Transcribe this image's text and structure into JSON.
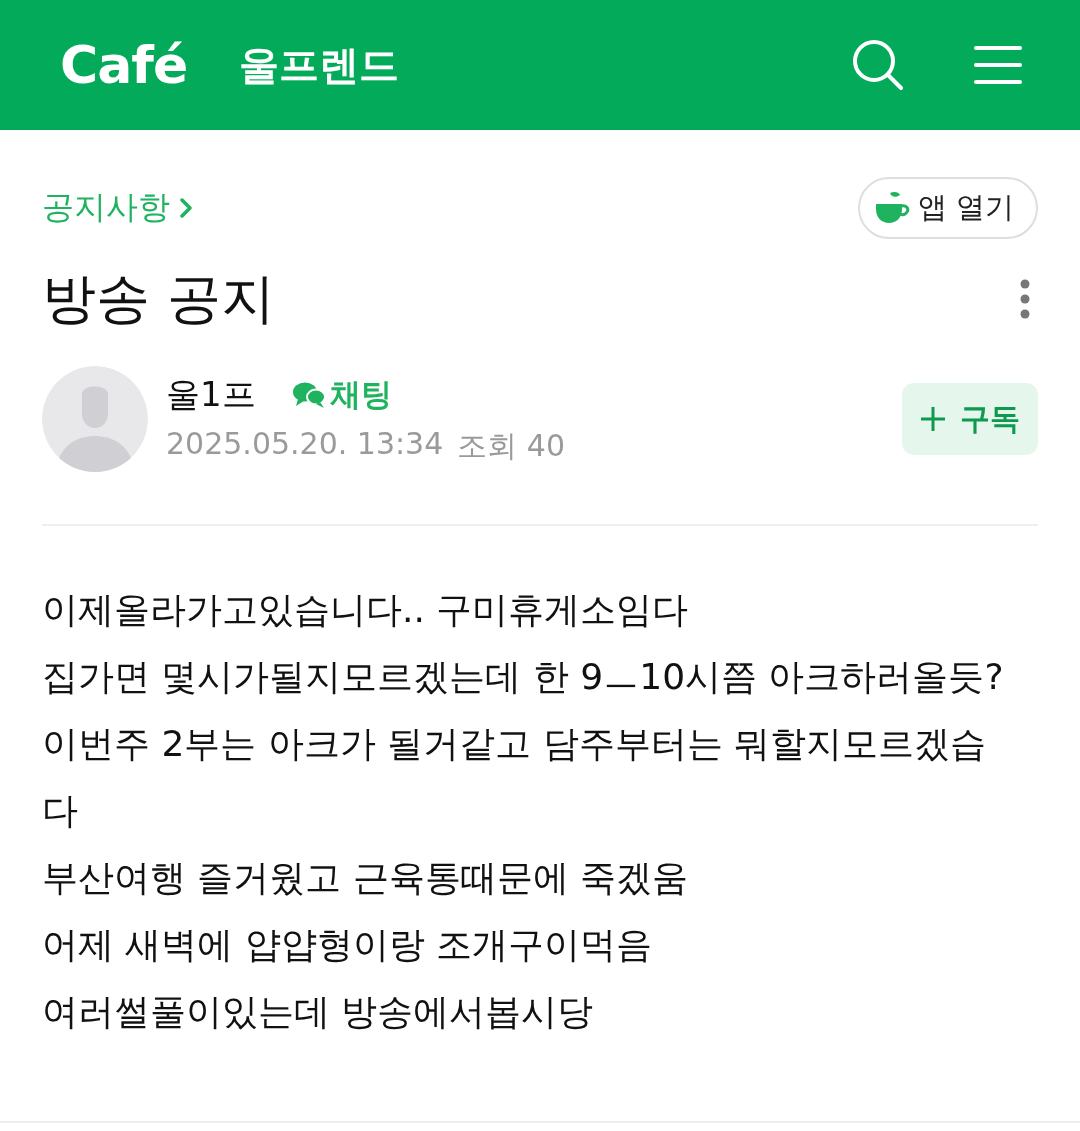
{
  "header": {
    "logo": "Café",
    "cafe_name": "울프렌드"
  },
  "breadcrumb": {
    "label": "공지사항"
  },
  "open_app_button": {
    "label": "앱 열기"
  },
  "post": {
    "title": "방송 공지",
    "author": {
      "name": "울1프",
      "chat_label": "채팅",
      "date": "2025.05.20. 13:34",
      "views": "조회 40"
    },
    "subscribe_button": {
      "label": "구독"
    },
    "body_lines": [
      "이제올라가고있습니다.. 구미휴게소임다",
      "집가면 몇시가될지모르겠는데 한 9ㅡ10시쯤 아크하러올듯?",
      "이번주 2부는 아크가 될거같고 담주부터는 뭐할지모르겠습",
      "다",
      "부산여행 즐거웠고 근육통때문에 죽겠움",
      "어제 새벽에 얍얍형이랑 조개구이먹음",
      "여러썰풀이있는데 방송에서봅시당"
    ]
  }
}
